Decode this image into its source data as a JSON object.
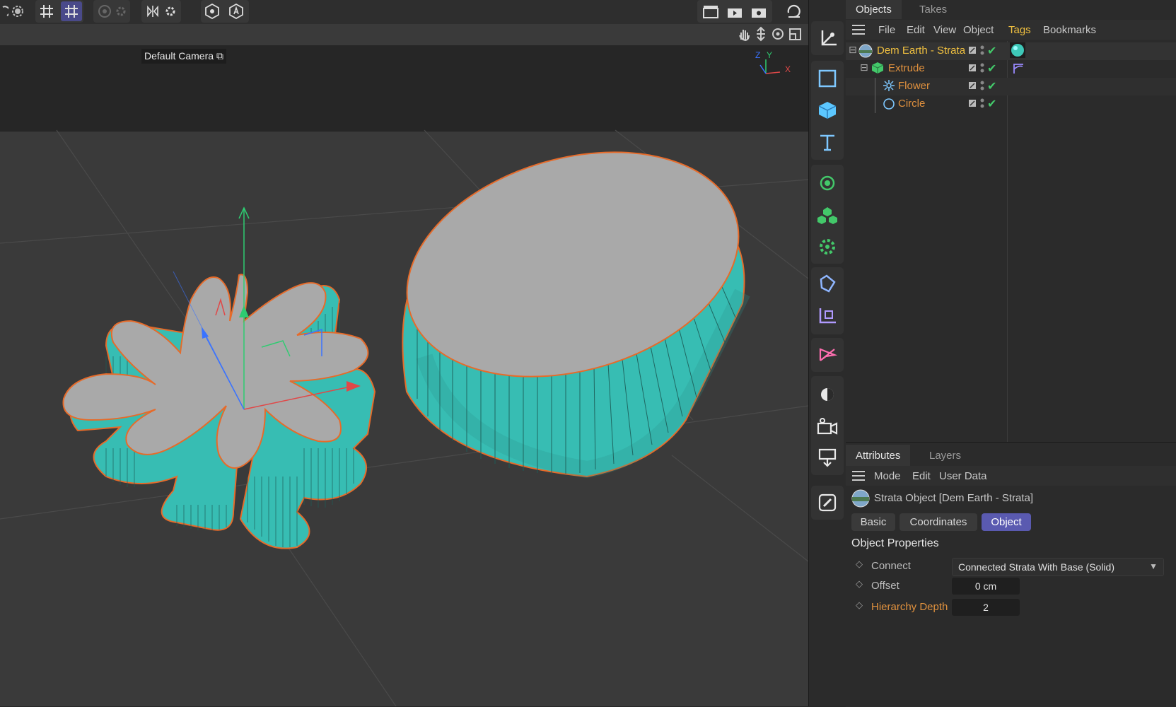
{
  "viewport": {
    "camera_label": "Default Camera",
    "axis_labels": {
      "z": "Z",
      "y": "Y",
      "x": "X"
    }
  },
  "objects_panel": {
    "tabs": [
      "Objects",
      "Takes"
    ],
    "menu": [
      "File",
      "Edit",
      "View",
      "Object",
      "Tags",
      "Bookmarks"
    ],
    "items": [
      {
        "name": "Dem Earth - Strata",
        "icon": "globe-icon",
        "expander": "⊟"
      },
      {
        "name": "Extrude",
        "icon": "cube-icon",
        "expander": "⊟"
      },
      {
        "name": "Flower",
        "icon": "flower-icon"
      },
      {
        "name": "Circle",
        "icon": "circle-icon"
      }
    ]
  },
  "attributes_panel": {
    "tabs": [
      "Attributes",
      "Layers"
    ],
    "menu": [
      "Mode",
      "Edit",
      "User Data"
    ],
    "object_title": "Strata Object [Dem Earth - Strata]",
    "buttons": [
      "Basic",
      "Coordinates",
      "Object"
    ],
    "active_button": "Object",
    "section_title": "Object Properties",
    "connect_label": "Connect",
    "connect_value": "Connected Strata With Base (Solid)",
    "offset_label": "Offset",
    "offset_value": "0 cm",
    "hierarchy_label": "Hierarchy Depth",
    "hierarchy_value": "2"
  },
  "colors": {
    "accent": "#5a5ab0",
    "object_name": "#e0913e",
    "highlight_name": "#f0c040",
    "teal": "#3ecdc0",
    "check": "#43c86a"
  }
}
